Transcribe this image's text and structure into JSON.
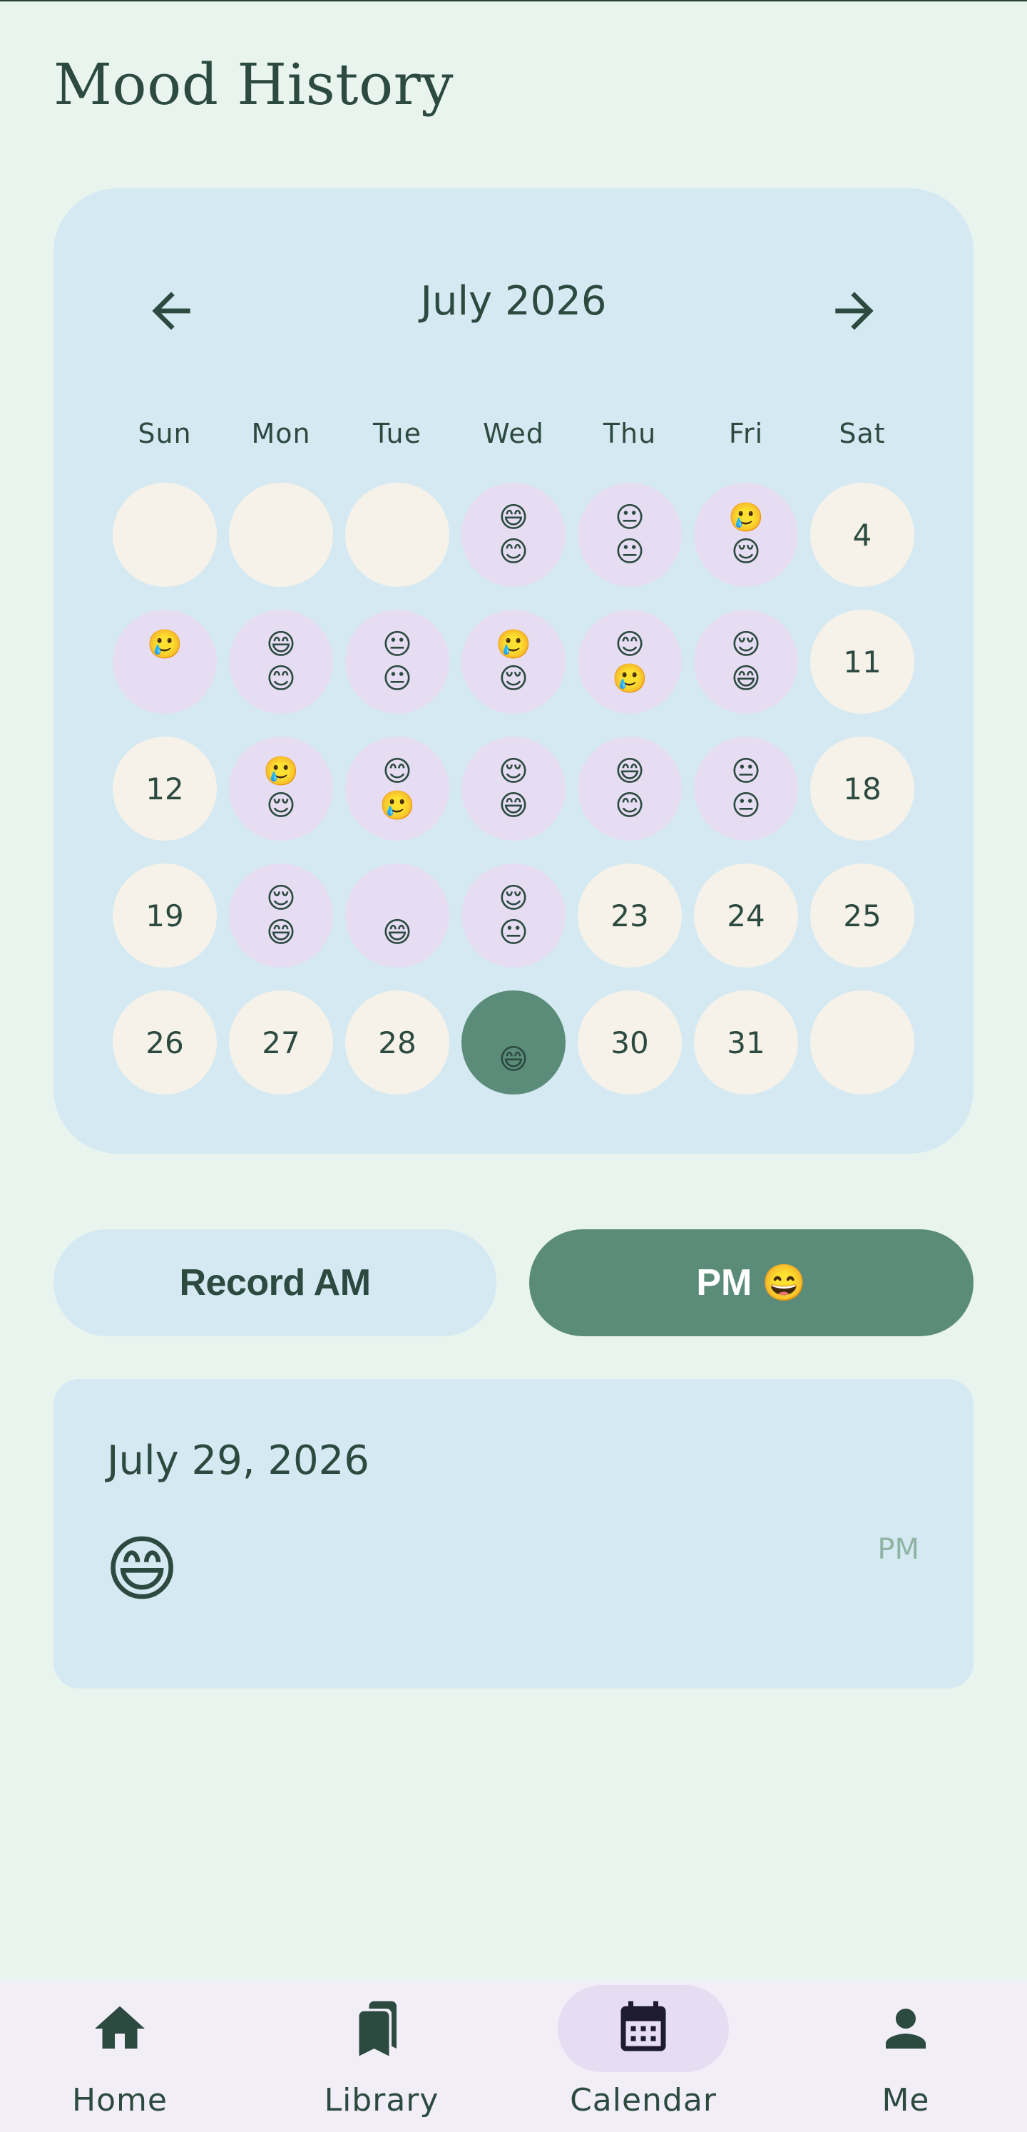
{
  "header": {
    "title": "Mood History"
  },
  "calendar": {
    "month_label": "July 2026",
    "weekdays": [
      "Sun",
      "Mon",
      "Tue",
      "Wed",
      "Thu",
      "Fri",
      "Sat"
    ],
    "days": [
      {
        "kind": "empty",
        "label": "",
        "am": "",
        "pm": ""
      },
      {
        "kind": "empty",
        "label": "",
        "am": "",
        "pm": ""
      },
      {
        "kind": "empty",
        "label": "",
        "am": "",
        "pm": ""
      },
      {
        "kind": "mood",
        "label": "",
        "am": "😄",
        "pm": "😊"
      },
      {
        "kind": "mood",
        "label": "",
        "am": "😐",
        "pm": "😐"
      },
      {
        "kind": "mood",
        "label": "",
        "am": "🥲",
        "pm": "😌"
      },
      {
        "kind": "plain",
        "label": "4",
        "am": "",
        "pm": ""
      },
      {
        "kind": "mood",
        "label": "",
        "am": "🥲",
        "pm": ""
      },
      {
        "kind": "mood",
        "label": "",
        "am": "😄",
        "pm": "😊"
      },
      {
        "kind": "mood",
        "label": "",
        "am": "😐",
        "pm": "😐"
      },
      {
        "kind": "mood",
        "label": "",
        "am": "🥲",
        "pm": "😌"
      },
      {
        "kind": "mood",
        "label": "",
        "am": "😊",
        "pm": "🥲"
      },
      {
        "kind": "mood",
        "label": "",
        "am": "😌",
        "pm": "😄"
      },
      {
        "kind": "plain",
        "label": "11",
        "am": "",
        "pm": ""
      },
      {
        "kind": "plain",
        "label": "12",
        "am": "",
        "pm": ""
      },
      {
        "kind": "mood",
        "label": "",
        "am": "🥲",
        "pm": "😌"
      },
      {
        "kind": "mood",
        "label": "",
        "am": "😊",
        "pm": "🥲"
      },
      {
        "kind": "mood",
        "label": "",
        "am": "😌",
        "pm": "😄"
      },
      {
        "kind": "mood",
        "label": "",
        "am": "😄",
        "pm": "😊"
      },
      {
        "kind": "mood",
        "label": "",
        "am": "😐",
        "pm": "😐"
      },
      {
        "kind": "plain",
        "label": "18",
        "am": "",
        "pm": ""
      },
      {
        "kind": "plain",
        "label": "19",
        "am": "",
        "pm": ""
      },
      {
        "kind": "mood",
        "label": "",
        "am": "😌",
        "pm": "😄"
      },
      {
        "kind": "mood",
        "label": "",
        "am": "",
        "pm": "😄"
      },
      {
        "kind": "mood",
        "label": "",
        "am": "😌",
        "pm": "😐"
      },
      {
        "kind": "plain",
        "label": "23",
        "am": "",
        "pm": ""
      },
      {
        "kind": "plain",
        "label": "24",
        "am": "",
        "pm": ""
      },
      {
        "kind": "plain",
        "label": "25",
        "am": "",
        "pm": ""
      },
      {
        "kind": "plain",
        "label": "26",
        "am": "",
        "pm": ""
      },
      {
        "kind": "plain",
        "label": "27",
        "am": "",
        "pm": ""
      },
      {
        "kind": "plain",
        "label": "28",
        "am": "",
        "pm": ""
      },
      {
        "kind": "selected",
        "label": "",
        "am": "",
        "pm": "😄"
      },
      {
        "kind": "plain",
        "label": "30",
        "am": "",
        "pm": ""
      },
      {
        "kind": "plain",
        "label": "31",
        "am": "",
        "pm": ""
      },
      {
        "kind": "empty",
        "label": "",
        "am": "",
        "pm": ""
      }
    ]
  },
  "actions": {
    "am_label": "Record AM",
    "pm_label": "PM",
    "pm_emoji": "😄"
  },
  "detail": {
    "date": "July 29, 2026",
    "emoji": "😄",
    "slot": "PM"
  },
  "bottom_nav": {
    "items": [
      {
        "label": "Home",
        "icon": "home-icon"
      },
      {
        "label": "Library",
        "icon": "library-icon"
      },
      {
        "label": "Calendar",
        "icon": "calendar-icon",
        "active": true
      },
      {
        "label": "Me",
        "icon": "person-icon"
      }
    ]
  },
  "colors": {
    "background": "#e9f4ef",
    "card": "#d4e9f1",
    "mood_day": "#e6ddf3",
    "plain_day": "#f6f2ea",
    "accent": "#5b8c79",
    "text": "#2d4a40"
  }
}
